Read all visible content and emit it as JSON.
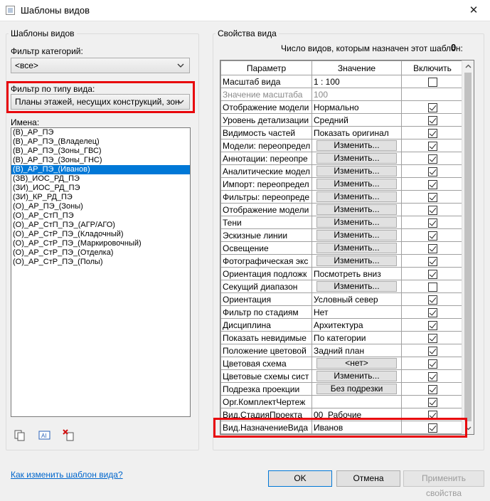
{
  "window": {
    "title": "Шаблоны видов",
    "close_glyph": "✕"
  },
  "left_group": {
    "title": "Шаблоны видов",
    "category_filter_label": "Фильтр категорий:",
    "category_filter_value": "<все>",
    "view_type_filter_label": "Фильтр по типу вида:",
    "view_type_filter_value": "Планы этажей, несущих конструкций, зон",
    "names_label": "Имена:",
    "names": [
      "(В)_АР_ПЭ",
      "(В)_АР_ПЭ_(Владелец)",
      "(В)_АР_ПЭ_(Зоны_ГВС)",
      "(В)_АР_ПЭ_(Зоны_ГНС)",
      "(В)_АР_ПЭ_(Иванов)",
      "(ЗВ)_ИОС_РД_ПЭ",
      "(ЗИ)_ИОС_РД_ПЭ",
      "(ЗИ)_КР_РД_ПЭ",
      "(О)_АР_ПЭ_(Зоны)",
      "(О)_АР_СтП_ПЭ",
      "(О)_АР_СтП_ПЭ_(АГР/АГО)",
      "(О)_АР_СтР_ПЭ_(Кладочный)",
      "(О)_АР_СтР_ПЭ_(Маркировочный)",
      "(О)_АР_СтР_ПЭ_(Отделка)",
      "(О)_АР_СтР_ПЭ_(Полы)"
    ],
    "selected_index": 4,
    "toolbar_icons": [
      "duplicate-icon",
      "rename-icon",
      "delete-icon"
    ]
  },
  "right_group": {
    "title": "Свойства вида",
    "count_label": "Число видов, которым назначен этот шаблон:",
    "count_value": "0",
    "columns": [
      "Параметр",
      "Значение",
      "Включить"
    ],
    "rows": [
      {
        "param": "Масштаб вида",
        "value": "1 : 100",
        "kind": "text",
        "include": false
      },
      {
        "param": "Значение масштаба",
        "value": "100",
        "kind": "text",
        "include": null,
        "disabled": true
      },
      {
        "param": "Отображение модели",
        "value": "Нормально",
        "kind": "text",
        "include": true
      },
      {
        "param": "Уровень детализации",
        "value": "Средний",
        "kind": "text",
        "include": true
      },
      {
        "param": "Видимость частей",
        "value": "Показать оригинал",
        "kind": "text",
        "include": true
      },
      {
        "param": "Модели: переопредел",
        "value": "Изменить...",
        "kind": "button",
        "include": true
      },
      {
        "param": "Аннотации: переопре",
        "value": "Изменить...",
        "kind": "button",
        "include": true
      },
      {
        "param": "Аналитические модел",
        "value": "Изменить...",
        "kind": "button",
        "include": true
      },
      {
        "param": "Импорт: переопредел",
        "value": "Изменить...",
        "kind": "button",
        "include": true
      },
      {
        "param": "Фильтры: переопреде",
        "value": "Изменить...",
        "kind": "button",
        "include": true
      },
      {
        "param": "Отображение модели",
        "value": "Изменить...",
        "kind": "button",
        "include": true
      },
      {
        "param": "Тени",
        "value": "Изменить...",
        "kind": "button",
        "include": true
      },
      {
        "param": "Эскизные линии",
        "value": "Изменить...",
        "kind": "button",
        "include": true
      },
      {
        "param": "Освещение",
        "value": "Изменить...",
        "kind": "button",
        "include": true
      },
      {
        "param": "Фотографическая экс",
        "value": "Изменить...",
        "kind": "button",
        "include": true
      },
      {
        "param": "Ориентация подложк",
        "value": "Посмотреть вниз",
        "kind": "text",
        "include": true
      },
      {
        "param": "Секущий диапазон",
        "value": "Изменить...",
        "kind": "button",
        "include": false
      },
      {
        "param": "Ориентация",
        "value": "Условный север",
        "kind": "text",
        "include": true
      },
      {
        "param": "Фильтр по стадиям",
        "value": "Нет",
        "kind": "text",
        "include": true
      },
      {
        "param": "Дисциплина",
        "value": "Архитектура",
        "kind": "text",
        "include": true
      },
      {
        "param": "Показать невидимые",
        "value": "По категории",
        "kind": "text",
        "include": true
      },
      {
        "param": "Положение цветовой",
        "value": "Задний план",
        "kind": "text",
        "include": true
      },
      {
        "param": "Цветовая схема",
        "value": "<нет>",
        "kind": "button",
        "include": true
      },
      {
        "param": "Цветовые схемы сист",
        "value": "Изменить...",
        "kind": "button",
        "include": true
      },
      {
        "param": "Подрезка проекции",
        "value": "Без подрезки",
        "kind": "button",
        "include": true
      },
      {
        "param": "Орг.КомплектЧертеж",
        "value": "",
        "kind": "text",
        "include": true
      },
      {
        "param": "Вид.СтадияПроекта",
        "value": "00_Рабочие",
        "kind": "text",
        "include": true
      },
      {
        "param": "Вид.НазначениеВида",
        "value": "Иванов",
        "kind": "text",
        "include": true
      }
    ]
  },
  "footer": {
    "help_link": "Как изменить шаблон вида?",
    "ok": "OK",
    "cancel": "Отмена",
    "apply": "Применить свойства"
  },
  "colors": {
    "highlight": "#e8060c",
    "selection": "#0078d7",
    "link": "#0066cc"
  }
}
